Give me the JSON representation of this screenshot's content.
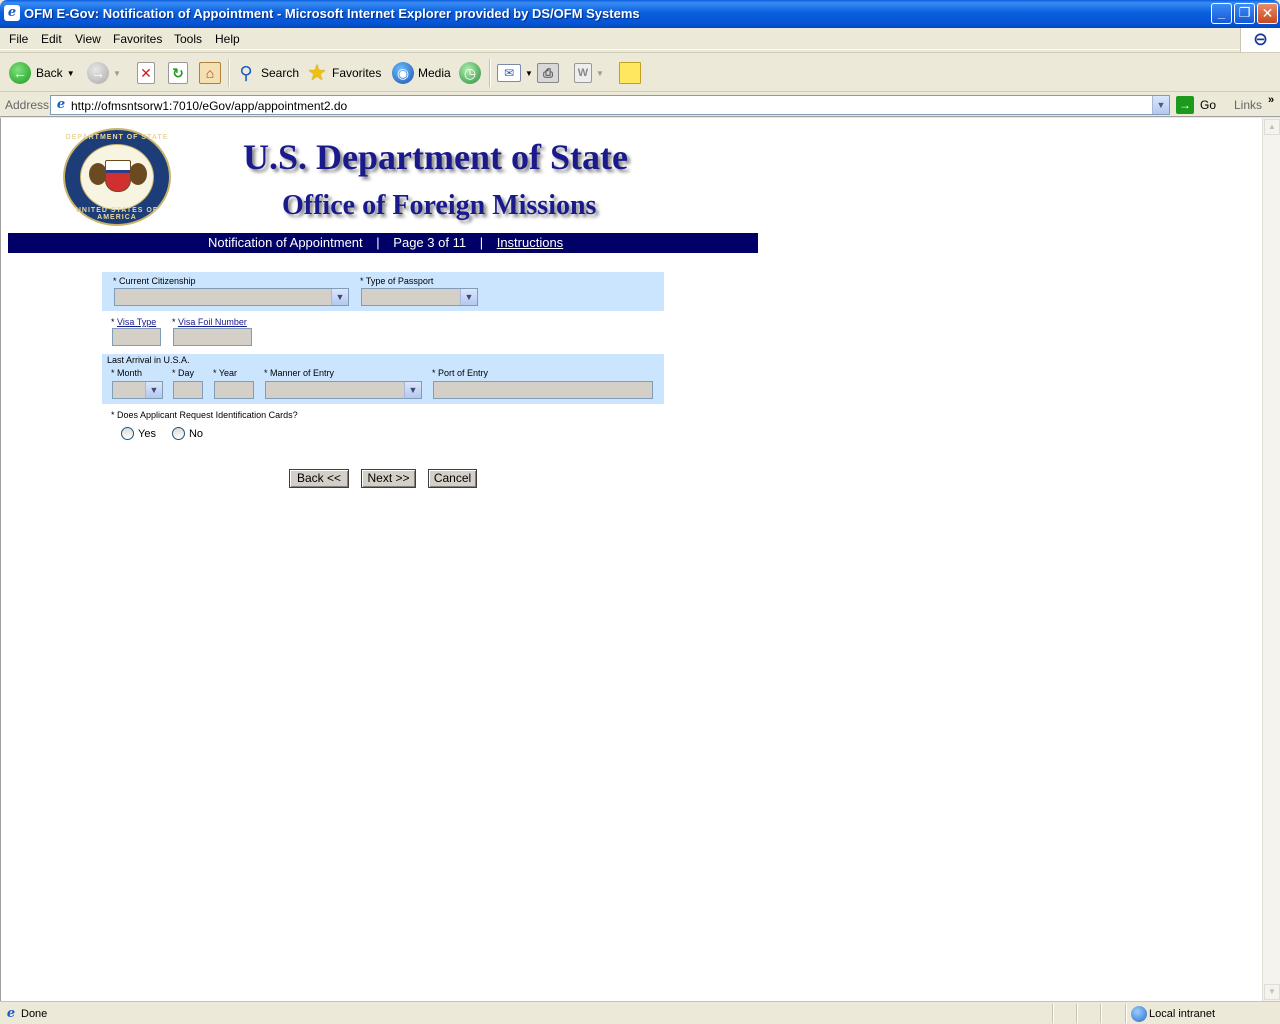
{
  "window": {
    "title": "OFM E-Gov: Notification of Appointment - Microsoft Internet Explorer provided by DS/OFM Systems",
    "minimize": "_",
    "maximize": "❐",
    "close": "✕"
  },
  "menu": [
    "File",
    "Edit",
    "View",
    "Favorites",
    "Tools",
    "Help"
  ],
  "toolbar": {
    "back_label": "Back",
    "search_label": "Search",
    "favorites_label": "Favorites",
    "media_label": "Media"
  },
  "address": {
    "label": "Address",
    "url": "http://ofmsntsorw1:7010/eGov/app/appointment2.do",
    "go_label": "Go",
    "links_label": "Links"
  },
  "page": {
    "seal_top": "DEPARTMENT OF STATE",
    "seal_bottom": "UNITED STATES OF AMERICA",
    "heading1": "U.S. Department of State",
    "heading2": "Office of Foreign Missions",
    "nav": {
      "section": "Notification of Appointment",
      "separator": "|",
      "page": "Page 3 of 11",
      "instructions": "Instructions"
    },
    "form": {
      "current_citizenship": "* Current Citizenship",
      "type_of_passport": "* Type of Passport",
      "visa_type_prefix": "* ",
      "visa_type": "Visa Type",
      "visa_foil_prefix": "* ",
      "visa_foil_number": "Visa Foil Number",
      "last_arrival": "Last Arrival in U.S.A.",
      "month": "* Month",
      "day": "* Day",
      "year": "* Year",
      "manner_of_entry": "* Manner of Entry",
      "port_of_entry": "* Port of Entry",
      "id_cards_question": "* Does Applicant Request Identification Cards?",
      "yes": "Yes",
      "no": "No"
    },
    "buttons": {
      "back": "Back <<",
      "next": "Next >>",
      "cancel": "Cancel"
    }
  },
  "status": {
    "text": "Done",
    "zone": "Local intranet"
  }
}
